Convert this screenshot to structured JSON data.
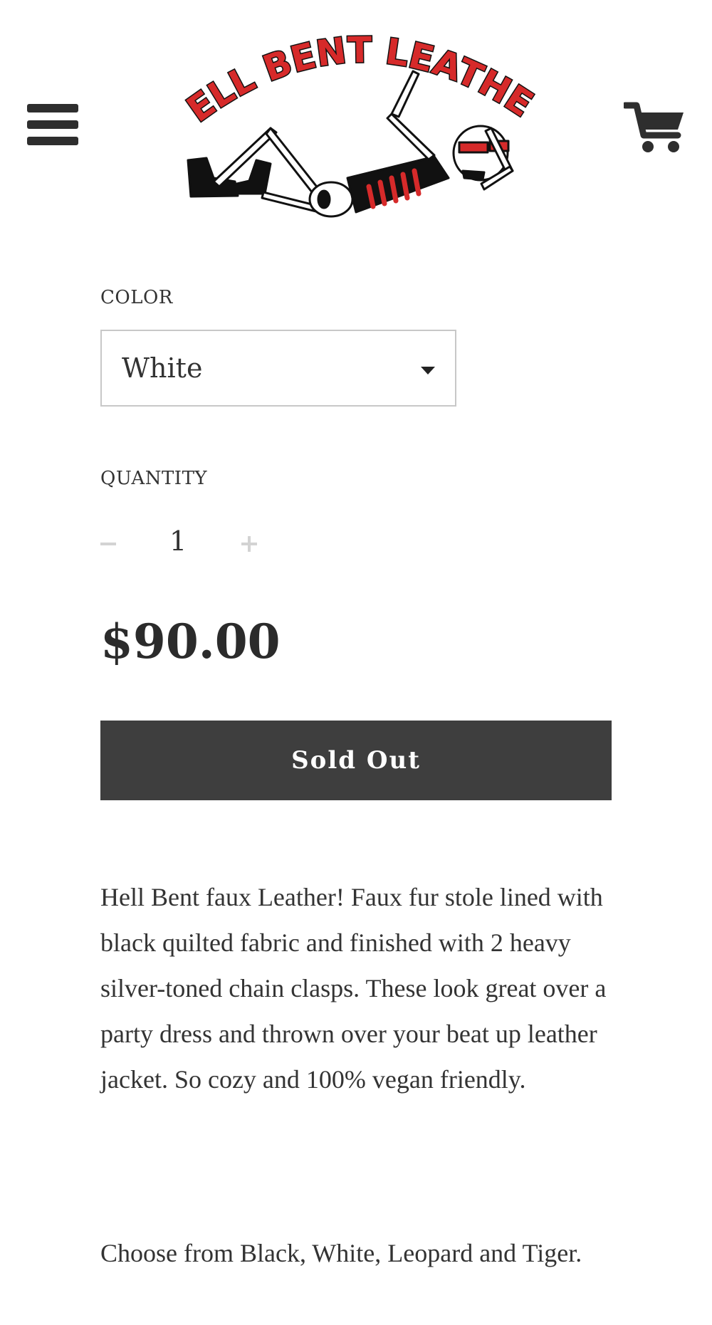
{
  "header": {
    "brand": "HELL BENT LEATHER",
    "menu_icon": "hamburger-menu-icon",
    "cart_icon": "shopping-cart-icon",
    "colors": {
      "icon": "#2e2e2e",
      "logo_red": "#d62a2a",
      "logo_black": "#111111"
    }
  },
  "color": {
    "label": "COLOR",
    "selected": "White"
  },
  "quantity": {
    "label": "QUANTITY",
    "value": "1",
    "minus_icon": "minus-icon",
    "plus_icon": "plus-icon"
  },
  "price": "$90.00",
  "button": {
    "label": "Sold Out",
    "color": "#3e3e3e"
  },
  "description": {
    "paragraph1": "Hell Bent faux Leather! Faux fur stole lined with black quilted fabric and finished with 2 heavy silver-toned chain clasps. These look great over a party dress and thrown over your beat up leather jacket. So cozy and 100% vegan friendly.",
    "paragraph2": "Choose from Black, White, Leopard and Tiger."
  }
}
